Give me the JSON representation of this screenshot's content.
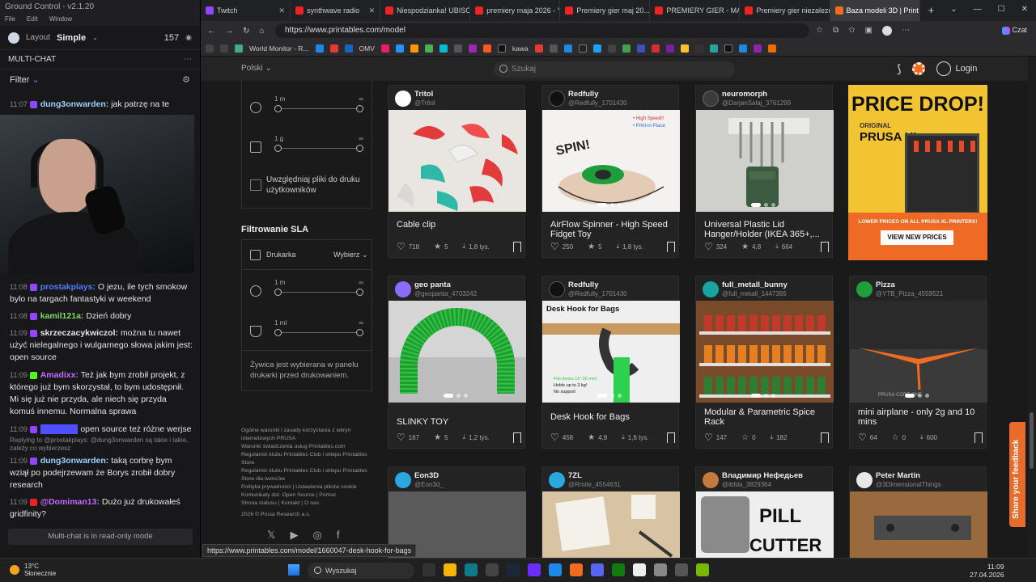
{
  "ground_control": {
    "title": "Ground Control - v2.1.20",
    "menu": [
      "File",
      "Edit",
      "Window"
    ],
    "layout_label": "Layout",
    "layout_value": "Simple",
    "viewer_count": "157",
    "multichat_title": "MULTI-CHAT",
    "filter_label": "Filter",
    "readonly_text": "Multi-chat is in read-only mode",
    "messages": [
      {
        "time": "11:07",
        "user": "dung3onwarden:",
        "text": "jak patrzę na te",
        "color": "#9bd0ff"
      },
      {
        "time": "11:08",
        "user": "prostakplays:",
        "text": "O jezu, ile tych smokow bylo na targach fantastyki w weekend",
        "color": "#4f7dff"
      },
      {
        "time": "11:08",
        "user": "kamil121a:",
        "text": "Dzień dobry",
        "color": "#7ddc5f"
      },
      {
        "time": "11:09",
        "user": "skrzeczacykwiczol:",
        "text": "można tu nawet użyć nielegalnego i wulgarnego słowa jakim jest: open source",
        "color": "#e6e6e6"
      },
      {
        "time": "11:09",
        "user": "Amadixx:",
        "text": "Też jak bym zrobił projekt, z którego już bym skorzystał, to bym udostępnił. Mi się już nie przyda, ale niech się przyda komuś innemu. Normalna sprawa",
        "color": "#c46bff"
      },
      {
        "time": "11:09",
        "user": "",
        "text": "open source też różne werjse",
        "color": "#4f4fff"
      },
      {
        "time": "",
        "user": "",
        "text": "Replying to @prostakplays: @dung3onwarden są takie i takie, zależy co wybierzesz",
        "color": "#888"
      },
      {
        "time": "11:09",
        "user": "dung3onwarden:",
        "text": "taką corbrę bym wziął po podejrzewam że Borys zrobił dobry research",
        "color": "#9bd0ff"
      },
      {
        "time": "11:09",
        "user": "@Domiman13:",
        "text": "Dużo już drukowałeś gridfinity?",
        "color": "#c46bff"
      }
    ]
  },
  "browser": {
    "tabs": [
      {
        "label": "Twitch",
        "color": "#9146ff"
      },
      {
        "label": "synthwave radio",
        "color": "#e22"
      },
      {
        "label": "Niespodzianka! UBISO",
        "color": "#e22"
      },
      {
        "label": "premiery maja 2026 - Y",
        "color": "#e22"
      },
      {
        "label": "Premiery gier maj 20...",
        "color": "#e22"
      },
      {
        "label": "PREMIERY GIER - MAJ",
        "color": "#e22"
      },
      {
        "label": "Premiery gier niezalezn",
        "color": "#e22"
      },
      {
        "label": "Baza modeli 3D | Print",
        "color": "#f26b22"
      }
    ],
    "url": "https://www.printables.com/model",
    "profile_label": "Czat",
    "favorites": [
      "World Monitor - R...",
      "OMV",
      "kawa"
    ]
  },
  "printables": {
    "language": "Polski",
    "search_placeholder": "Szukaj",
    "login": "Login",
    "filters": {
      "time_min": "1 m",
      "time_max": "∞",
      "weight_min": "1 g",
      "weight_max": "∞",
      "include_user_files": "Uwzględniaj pliki do druku użytkowników",
      "sla_title": "Filtrowanie SLA",
      "printer_label": "Drukarka",
      "printer_select": "Wybierz",
      "sla_time_min": "1 m",
      "sla_time_max": "∞",
      "resin_min": "1 ml",
      "resin_max": "∞",
      "resin_note": "Żywica jest wybierana w panelu drukarki przed drukowaniem."
    },
    "footer": {
      "links": [
        "Ogólne warunki i zasady korzystania z witryn internetowych PRUSA",
        "Warunki świadczenia usług Printables.com",
        "Regulamin klubu Printables Club i sklepu Printables Store",
        "Regulamin klubu Printables Club i sklepu Printables Store dla twórców",
        "Polityka prywatności | Ustawienia plików cookie",
        "Komunikaty dot. Open Source | Pomoc",
        "Strona statusu | Kontakt | O nas"
      ],
      "copyright": "2026 © Prusa Research a.s."
    },
    "cards": [
      {
        "name": "Tritol",
        "handle": "@Tritol",
        "title": "Cable clip",
        "likes": "718",
        "rating": "5",
        "downloads": "1,8 tys.",
        "avatar": "#ffffff"
      },
      {
        "name": "Redfully",
        "handle": "@Redfully_1701430",
        "title": "AirFlow Spinner - High Speed Fidget Toy",
        "likes": "250",
        "rating": "5",
        "downloads": "1,8 tys.",
        "avatar": "#111111"
      },
      {
        "name": "neuromorph",
        "handle": "@DarjanSalaj_3761299",
        "title": "Universal Plastic Lid Hanger/Holder (IKEA 365+,...",
        "likes": "324",
        "rating": "4,8",
        "downloads": "664",
        "avatar": "#3b3b3b"
      },
      {
        "name": "geo panta",
        "handle": "@geopanta_4703242",
        "title": "SLINKY TOY",
        "likes": "167",
        "rating": "5",
        "downloads": "1,2 tys.",
        "avatar": "#8a6cff"
      },
      {
        "name": "Redfully",
        "handle": "@Redfully_1701430",
        "title": "Desk Hook for Bags",
        "likes": "458",
        "rating": "4,8",
        "downloads": "1,6 tys.",
        "avatar": "#111111"
      },
      {
        "name": "full_metall_bunny",
        "handle": "@full_metall_1447365",
        "title": "Modular & Parametric Spice Rack",
        "likes": "147",
        "rating": "0",
        "downloads": "182",
        "avatar": "#1aa3a3"
      },
      {
        "name": "Pizza",
        "handle": "@YTB_Pizza_4559521",
        "title": "mini airplane - only 2g and 10 mins",
        "likes": "64",
        "rating": "0",
        "downloads": "600",
        "avatar": "#1f9e3a"
      },
      {
        "name": "Eon3D",
        "handle": "@Eon3d_",
        "title": "",
        "likes": "",
        "rating": "",
        "downloads": "",
        "avatar": "#2aa7e0"
      },
      {
        "name": "7ZL",
        "handle": "@Rmite_4554631",
        "title": "",
        "likes": "",
        "rating": "",
        "downloads": "",
        "avatar": "#2aa7e0"
      },
      {
        "name": "Владимир Нефедьев",
        "handle": "@ibfda_3829364",
        "title": "",
        "likes": "",
        "rating": "",
        "downloads": "",
        "avatar": "#c47a3c"
      },
      {
        "name": "Peter Martin",
        "handle": "@3DimensionalThings",
        "title": "",
        "likes": "",
        "rating": "",
        "downloads": "",
        "avatar": "#e8e8e8"
      }
    ],
    "card_image_texts": {
      "spinner_spin": "SPIN!",
      "spinner_note": "• High Speed!!",
      "spinner_note2": "• Print-in-Place",
      "hook_title": "Desk Hook for Bags",
      "hook_notes": [
        "Fits desks 10~30 mm!",
        "Holds up to 3 kg!",
        "No support"
      ],
      "plane_brand": "PRUSA CORE ONE",
      "pill": "PILL",
      "cutter": "CUTTER"
    },
    "ad": {
      "headline": "PRICE DROP!",
      "original": "ORIGINAL",
      "product": "PRUSA XL",
      "subline": "LOWER PRICES ON ALL PRUSA XL PRINTERS!",
      "button": "VIEW NEW PRICES"
    },
    "status_url": "https://www.printables.com/model/1660047-desk-hook-for-bags",
    "feedback": "Share your feedback"
  },
  "taskbar": {
    "temperature": "13°C",
    "weather": "Słonecznie",
    "search": "Wyszukaj",
    "time": "11:09",
    "date": "27.04.2026"
  }
}
